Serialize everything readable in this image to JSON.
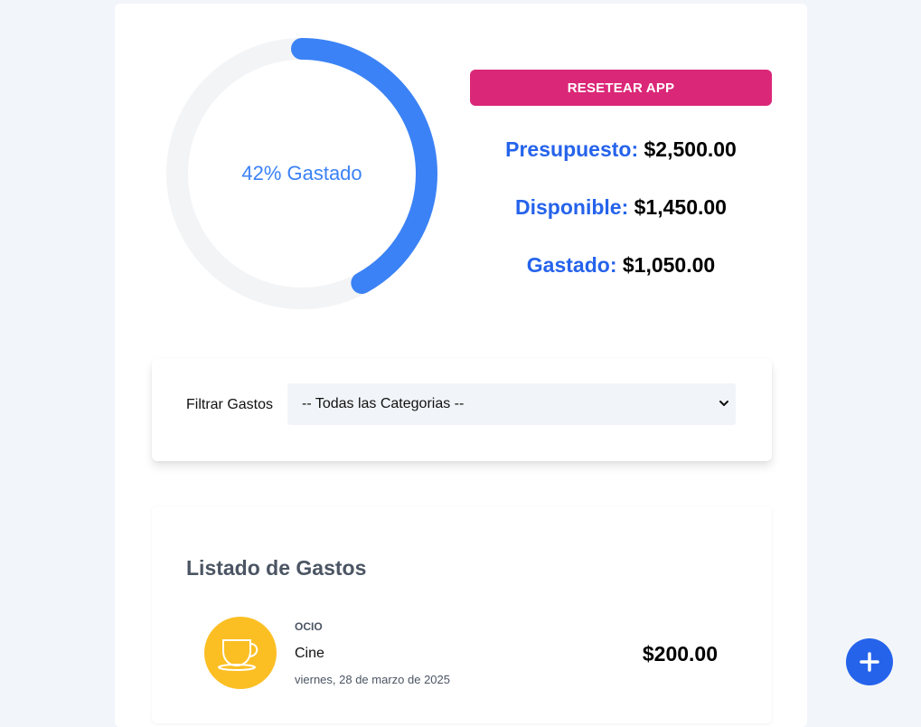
{
  "progress": {
    "percent": 42,
    "label": "42% Gastado",
    "track_color": "#f3f4f6",
    "fill_color": "#3b82f6"
  },
  "actions": {
    "reset_label": "Resetear App"
  },
  "stats": {
    "budget_label": "Presupuesto:",
    "budget_value": "$2,500.00",
    "available_label": "Disponible:",
    "available_value": "$1,450.00",
    "spent_label": "Gastado:",
    "spent_value": "$1,050.00"
  },
  "filter": {
    "label": "Filtrar Gastos",
    "selected": "-- Todas las Categorias --"
  },
  "list": {
    "title": "Listado de Gastos",
    "items": [
      {
        "category": "Ocio",
        "name": "Cine",
        "date": "viernes, 28 de marzo de 2025",
        "amount": "$200.00",
        "icon": "cup-icon",
        "icon_color": "#fbbf24"
      }
    ]
  },
  "colors": {
    "accent": "#2563eb",
    "reset": "#db2777",
    "background": "#f2f5f9"
  },
  "fab": {
    "icon": "plus-icon"
  }
}
